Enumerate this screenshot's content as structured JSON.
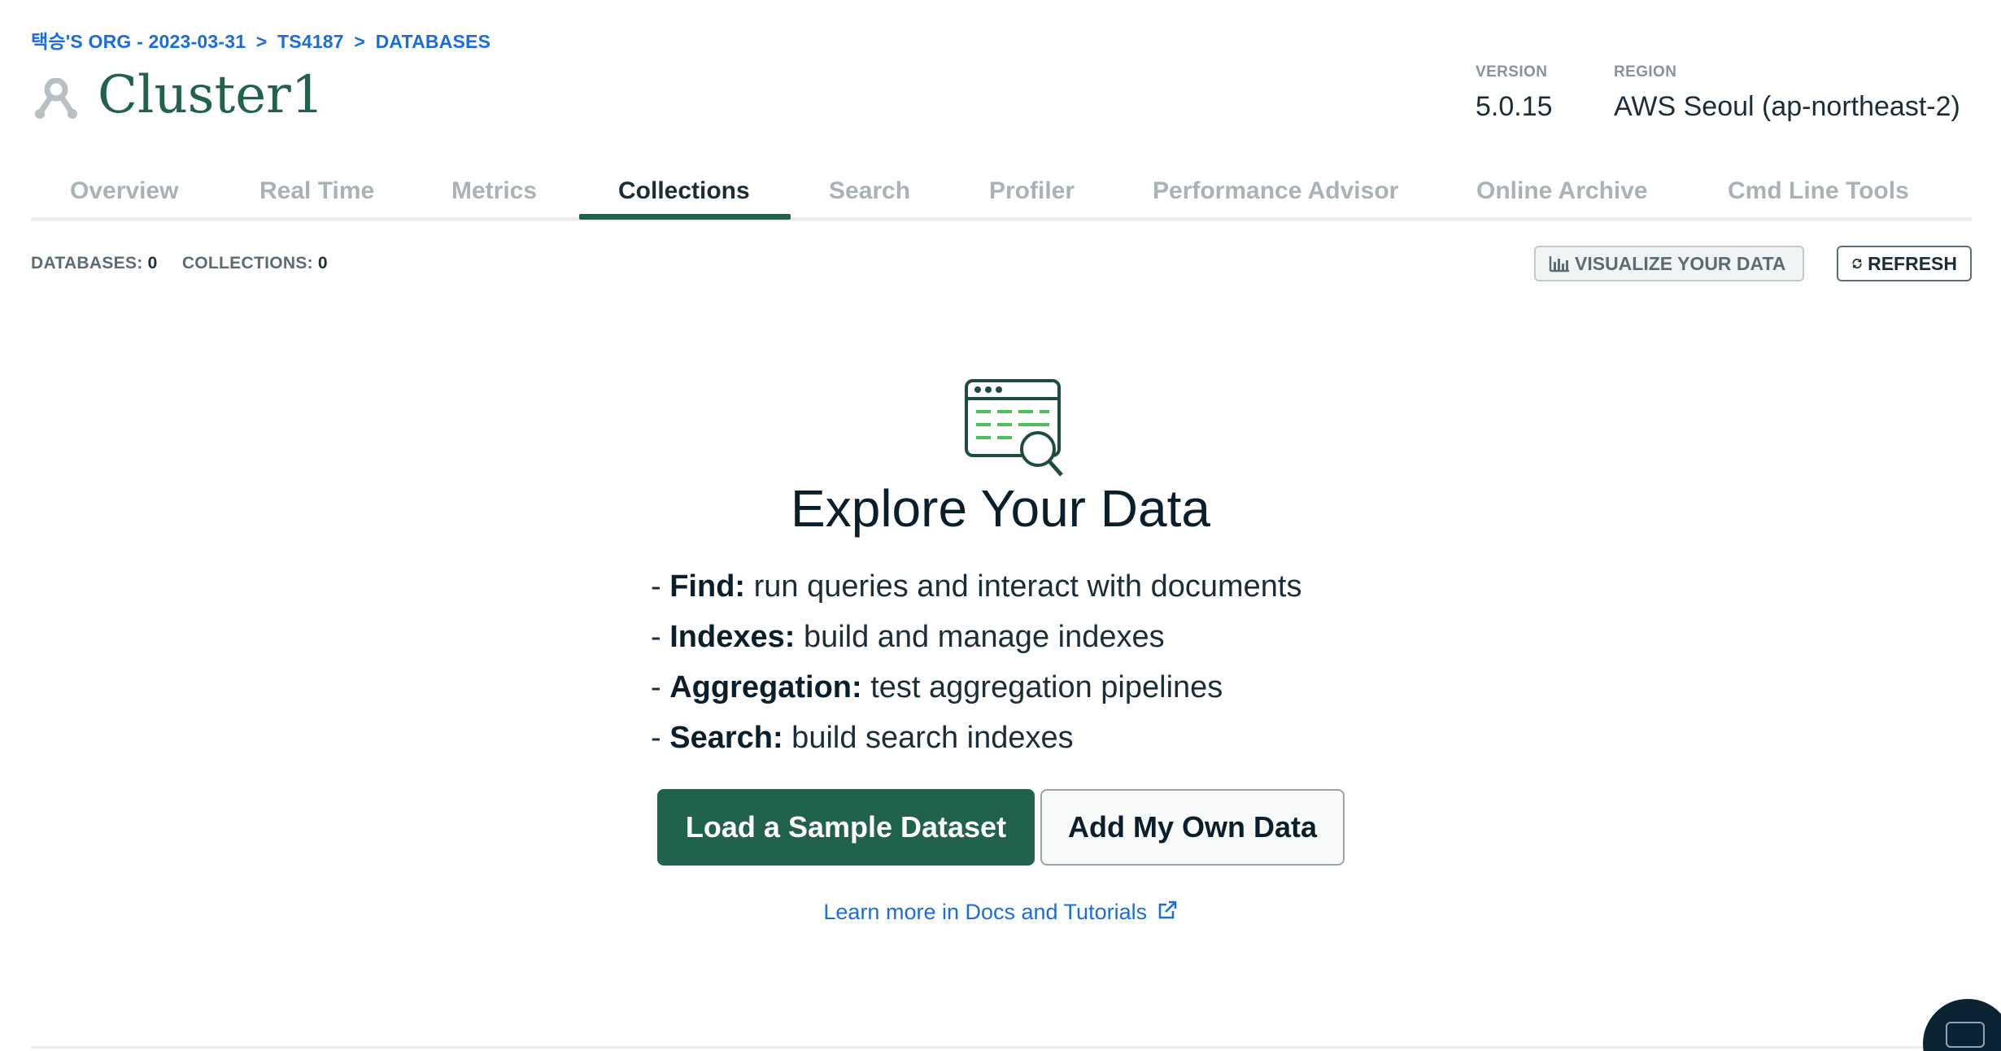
{
  "breadcrumb": {
    "org": "택승'S ORG - 2023-03-31",
    "sep1": ">",
    "project": "TS4187",
    "sep2": ">",
    "section": "DATABASES"
  },
  "cluster": {
    "name": "Cluster1",
    "version_label": "VERSION",
    "version": "5.0.15",
    "region_label": "REGION",
    "region": "AWS Seoul (ap-northeast-2)"
  },
  "tabs": [
    {
      "label": "Overview",
      "active": false
    },
    {
      "label": "Real Time",
      "active": false
    },
    {
      "label": "Metrics",
      "active": false
    },
    {
      "label": "Collections",
      "active": true
    },
    {
      "label": "Search",
      "active": false
    },
    {
      "label": "Profiler",
      "active": false
    },
    {
      "label": "Performance Advisor",
      "active": false
    },
    {
      "label": "Online Archive",
      "active": false
    },
    {
      "label": "Cmd Line Tools",
      "active": false
    }
  ],
  "counts": {
    "databases_label": "DATABASES:",
    "databases": "0",
    "collections_label": "COLLECTIONS:",
    "collections": "0"
  },
  "toolbar": {
    "visualize_label": "VISUALIZE YOUR DATA",
    "refresh_label": "REFRESH"
  },
  "empty_state": {
    "title": "Explore Your Data",
    "features": [
      {
        "prefix": "- ",
        "name": "Find:",
        "desc": " run queries and interact with documents"
      },
      {
        "prefix": "- ",
        "name": "Indexes:",
        "desc": " build and manage indexes"
      },
      {
        "prefix": "- ",
        "name": "Aggregation:",
        "desc": " test aggregation pipelines"
      },
      {
        "prefix": "- ",
        "name": "Search:",
        "desc": " build search indexes"
      }
    ],
    "primary_button": "Load a Sample Dataset",
    "secondary_button": "Add My Own Data",
    "learn_link": "Learn more in Docs and Tutorials"
  },
  "colors": {
    "accent_green": "#21634a",
    "link_blue": "#1a6de0",
    "icon_light_green": "#4cc05b"
  },
  "icons": {
    "cluster": "cluster-icon",
    "visualize": "bar-chart-icon",
    "refresh": "refresh-icon",
    "explore": "browser-search-icon",
    "external": "external-link-icon",
    "chat": "chat-support-icon"
  }
}
